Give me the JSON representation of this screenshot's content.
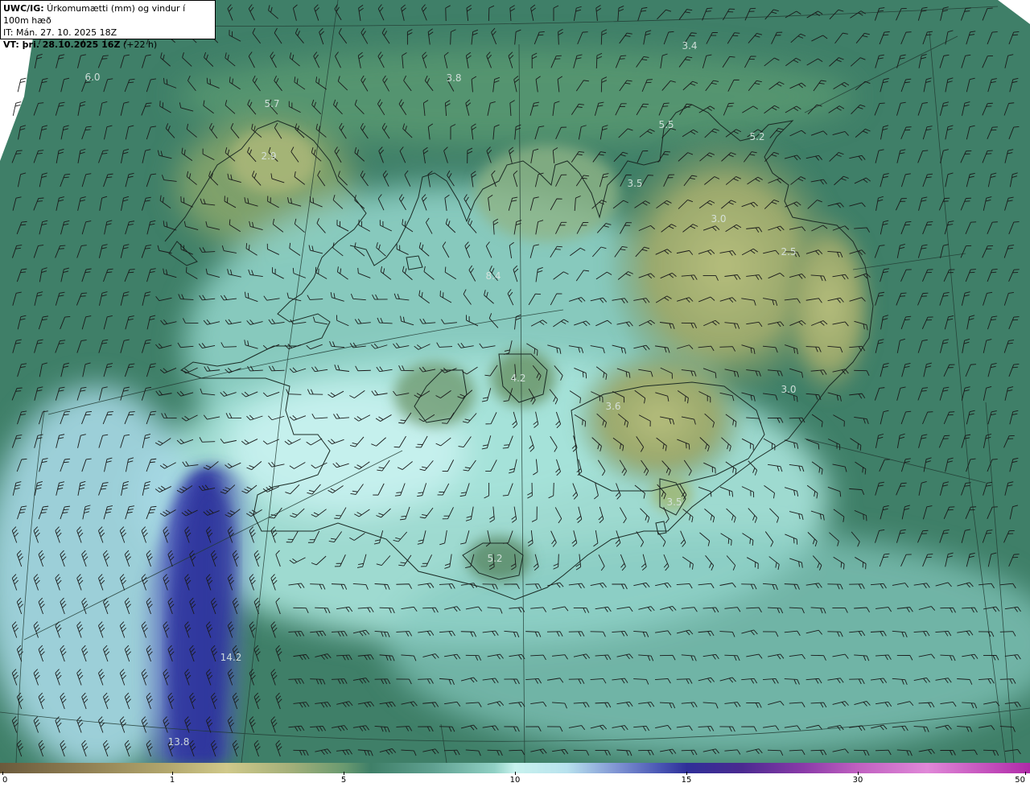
{
  "header": {
    "source_bold": "UWC/IG:",
    "title_rest": " Úrkomumætti (mm) og vindur í 100m hæð",
    "init_time": "IT: Mán. 27. 10. 2025 18Z",
    "valid_bold": "VT: þri. 28.10.2025 16Z",
    "valid_rest": " (+22 h)"
  },
  "colors": {
    "sea_green": "#3f7f68",
    "land_yellow": "#a9b676",
    "moist_cyan": "#b8ece6",
    "heavy_blue": "#4a57b4",
    "deep_blue": "#3037a0"
  },
  "value_labels": [
    {
      "text": "6.0"
    },
    {
      "text": "5.7"
    },
    {
      "text": "3.8"
    },
    {
      "text": "3.4"
    },
    {
      "text": "2.9"
    },
    {
      "text": "5.5"
    },
    {
      "text": "5.2"
    },
    {
      "text": "3.5"
    },
    {
      "text": "3.0"
    },
    {
      "text": "2.5"
    },
    {
      "text": "8.4"
    },
    {
      "text": "4.2"
    },
    {
      "text": "3.6"
    },
    {
      "text": "3.0"
    },
    {
      "text": "3.5"
    },
    {
      "text": "5.2"
    },
    {
      "text": "14.2"
    },
    {
      "text": "13.8"
    }
  ],
  "colorbar": {
    "ticks": [
      "0",
      "1",
      "5",
      "10",
      "15",
      "30",
      "50"
    ]
  },
  "icons": {
    "wind_barb": "wind-barb-icon"
  }
}
